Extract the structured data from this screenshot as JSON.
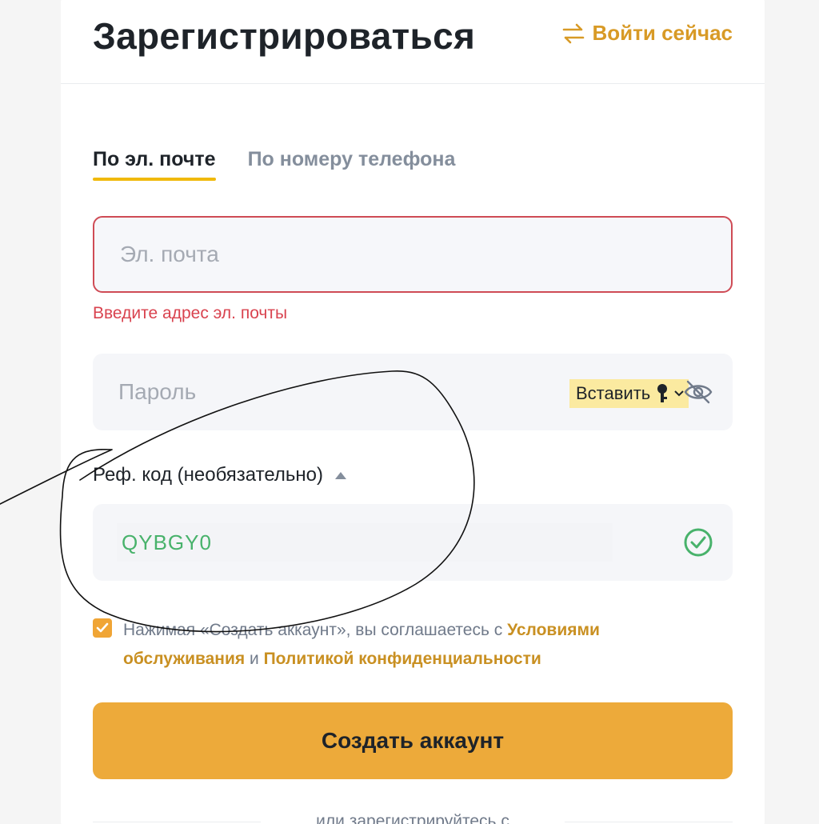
{
  "header": {
    "title": "Зарегистрироваться",
    "login_label": "Войти сейчас"
  },
  "tabs": [
    {
      "label": "По эл. почте",
      "active": true
    },
    {
      "label": "По номеру телефона",
      "active": false
    }
  ],
  "email": {
    "placeholder": "Эл. почта",
    "value": "",
    "error": "Введите адрес эл. почты"
  },
  "password": {
    "placeholder": "Пароль",
    "value": "",
    "paste_label": "Вставить"
  },
  "referral": {
    "label": "Реф. код (необязательно)",
    "value": "QYBGY0"
  },
  "terms": {
    "checked": true,
    "prefix": "Нажимая «Создать аккаунт», вы соглашаетесь с ",
    "tos_link": "Условиями обслуживания",
    "middle": " и ",
    "privacy_link": "Политикой конфиденциальности"
  },
  "create_button": "Создать аккаунт",
  "alt_signup": "или зарегистрируйтесь с",
  "colors": {
    "accent": "#d89a26",
    "button": "#edaa3a",
    "error": "#cf4b55",
    "success": "#48b26b"
  }
}
